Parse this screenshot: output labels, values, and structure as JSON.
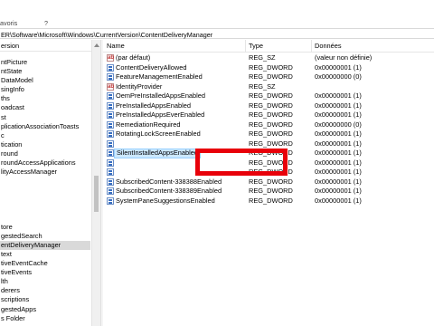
{
  "menu": {
    "favorites": "avoris",
    "help": "?"
  },
  "address": "ER\\Software\\Microsoft\\Windows\\CurrentVersion\\ContentDeliveryManager",
  "tree": {
    "header": "ersion",
    "items": [
      "ntPicture",
      "ntState",
      "DataModel",
      "singInfo",
      "ths",
      "oadcast",
      "st",
      "plicationAssociationToasts",
      "c",
      "tication",
      "round",
      "roundAccessApplications",
      "lityAccessManager",
      "",
      "",
      "",
      "",
      "",
      "tore",
      "gestedSearch",
      "entDeliveryManager",
      "text",
      "tiveEventCache",
      "tiveEvents",
      "lth",
      "derers",
      "scriptions",
      "gestedApps",
      "s Folder"
    ],
    "selected_index": 20
  },
  "columns": {
    "name": "Name",
    "type": "Type",
    "data": "Données"
  },
  "rows": [
    {
      "name": "(par défaut)",
      "type": "REG_SZ",
      "data": "(valeur non définie)",
      "icon": "string-value-icon"
    },
    {
      "name": "ContentDeliveryAllowed",
      "type": "REG_DWORD",
      "data": "0x00000001 (1)",
      "icon": "dword-value-icon"
    },
    {
      "name": "FeatureManagementEnabled",
      "type": "REG_DWORD",
      "data": "0x00000000 (0)",
      "icon": "dword-value-icon"
    },
    {
      "name": "IdentityProvider",
      "type": "REG_SZ",
      "data": "",
      "icon": "string-value-icon"
    },
    {
      "name": "OemPreInstalledAppsEnabled",
      "type": "REG_DWORD",
      "data": "0x00000001 (1)",
      "icon": "dword-value-icon"
    },
    {
      "name": "PreInstalledAppsEnabled",
      "type": "REG_DWORD",
      "data": "0x00000001 (1)",
      "icon": "dword-value-icon"
    },
    {
      "name": "PreInstalledAppsEverEnabled",
      "type": "REG_DWORD",
      "data": "0x00000001 (1)",
      "icon": "dword-value-icon"
    },
    {
      "name": "RemediationRequired",
      "type": "REG_DWORD",
      "data": "0x00000000 (0)",
      "icon": "dword-value-icon"
    },
    {
      "name": "RotatingLockScreenEnabled",
      "type": "REG_DWORD",
      "data": "0x00000001 (1)",
      "icon": "dword-value-icon"
    },
    {
      "name": "",
      "type": "REG_DWORD",
      "data": "0x00000001 (1)",
      "icon": "dword-value-icon"
    },
    {
      "name": "SilentInstalledAppsEnabled",
      "type": "REG_DWORD",
      "data": "0x00000001 (1)",
      "icon": "dword-value-icon",
      "selected": true
    },
    {
      "name": "",
      "type": "REG_DWORD",
      "data": "0x00000001 (1)",
      "icon": "dword-value-icon"
    },
    {
      "name": "",
      "type": "REG_DWORD",
      "data": "0x00000001 (1)",
      "icon": "dword-value-icon"
    },
    {
      "name": "SubscribedContent-338388Enabled",
      "type": "REG_DWORD",
      "data": "0x00000001 (1)",
      "icon": "dword-value-icon"
    },
    {
      "name": "SubscribedContent-338389Enabled",
      "type": "REG_DWORD",
      "data": "0x00000001 (1)",
      "icon": "dword-value-icon"
    },
    {
      "name": "SystemPaneSuggestionsEnabled",
      "type": "REG_DWORD",
      "data": "0x00000001 (1)",
      "icon": "dword-value-icon"
    }
  ],
  "highlight_color": "#e8000a",
  "selection_color": "#cce8ff"
}
